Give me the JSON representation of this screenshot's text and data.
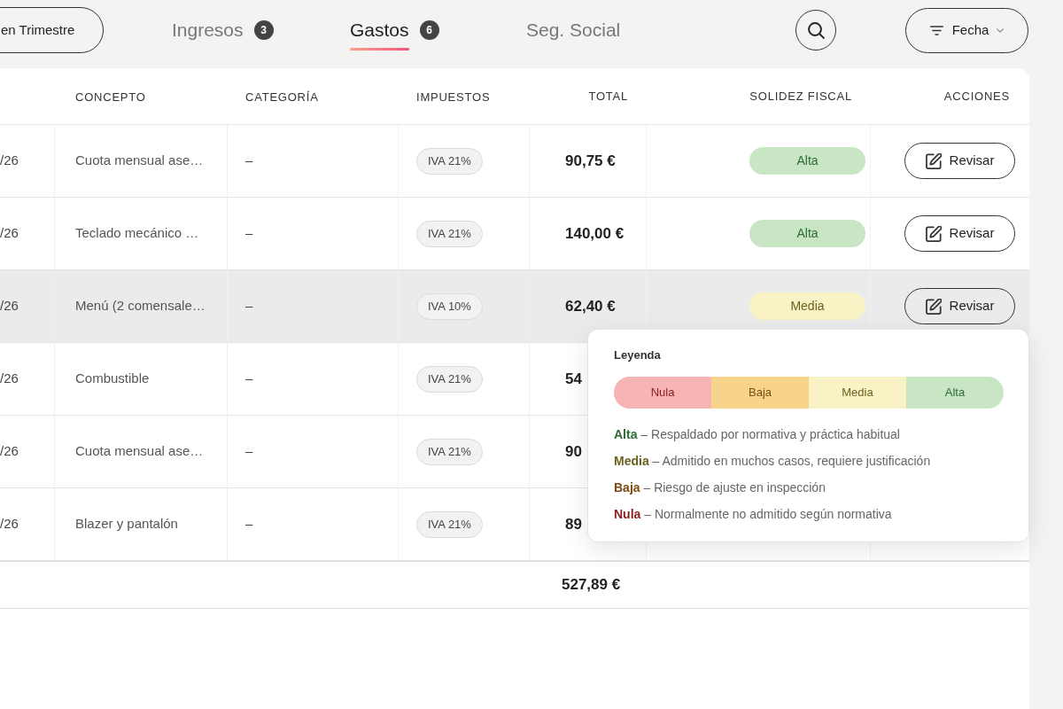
{
  "toolbar": {
    "period_button": {
      "label": "en Trimestre"
    },
    "tabs": [
      {
        "label": "Ingresos",
        "count": "3",
        "selected": false
      },
      {
        "label": "Gastos",
        "count": "6",
        "selected": true
      },
      {
        "label": "Seg. Social",
        "selected": false
      }
    ],
    "filter_button": {
      "label": "Fecha"
    }
  },
  "table": {
    "columns": [
      "CONCEPTO",
      "CATEGORÍA",
      "IMPUESTOS",
      "TOTAL",
      "SOLIDEZ FISCAL",
      "ACCIONES"
    ],
    "rows": [
      {
        "column_1": "/26",
        "concepto": "Cuota mensual ase…",
        "categoria": "–",
        "impuestos": "IVA 21%",
        "total": "90,75 €",
        "solidez": {
          "label": "Alta",
          "kind": "high"
        },
        "action": "Revisar",
        "highlighted": false
      },
      {
        "column_1": "/26",
        "concepto": "Teclado mecánico …",
        "categoria": "–",
        "impuestos": "IVA 21%",
        "total": "140,00 €",
        "solidez": {
          "label": "Alta",
          "kind": "high"
        },
        "action": "Revisar",
        "highlighted": false
      },
      {
        "column_1": "/26",
        "concepto": "Menú (2 comensale…",
        "categoria": "–",
        "impuestos": "IVA 10%",
        "total": "62,40 €",
        "solidez": {
          "label": "Media",
          "kind": "medium"
        },
        "action": "Revisar",
        "highlighted": true
      },
      {
        "column_1": "/26",
        "concepto": "Combustible",
        "categoria": "–",
        "impuestos": "IVA 21%",
        "total": "54",
        "highlighted": false
      },
      {
        "column_1": "/26",
        "concepto": "Cuota mensual ase…",
        "categoria": "–",
        "impuestos": "IVA 21%",
        "total": "90",
        "highlighted": false
      },
      {
        "column_1": "/26",
        "concepto": "Blazer y pantalón",
        "categoria": "–",
        "impuestos": "IVA 21%",
        "total": "89",
        "highlighted": false
      }
    ],
    "footer": {
      "total": "527,89 €"
    }
  },
  "legend": {
    "title": "Leyenda",
    "scale": [
      {
        "label": "Nula",
        "kind": "zero"
      },
      {
        "label": "Baja",
        "kind": "low"
      },
      {
        "label": "Media",
        "kind": "medium"
      },
      {
        "label": "Alta",
        "kind": "high"
      }
    ],
    "items": [
      {
        "kind": "high",
        "term": "Alta",
        "text": "– Respaldado por normativa y práctica habitual"
      },
      {
        "kind": "medium",
        "term": "Media",
        "text": "– Admitido en muchos casos, requiere justificación"
      },
      {
        "kind": "low",
        "term": "Baja",
        "text": "– Riesgo de ajuste en inspección"
      },
      {
        "kind": "zero",
        "term": "Nula",
        "text": "– Normalmente no admitido según normativa"
      }
    ]
  }
}
